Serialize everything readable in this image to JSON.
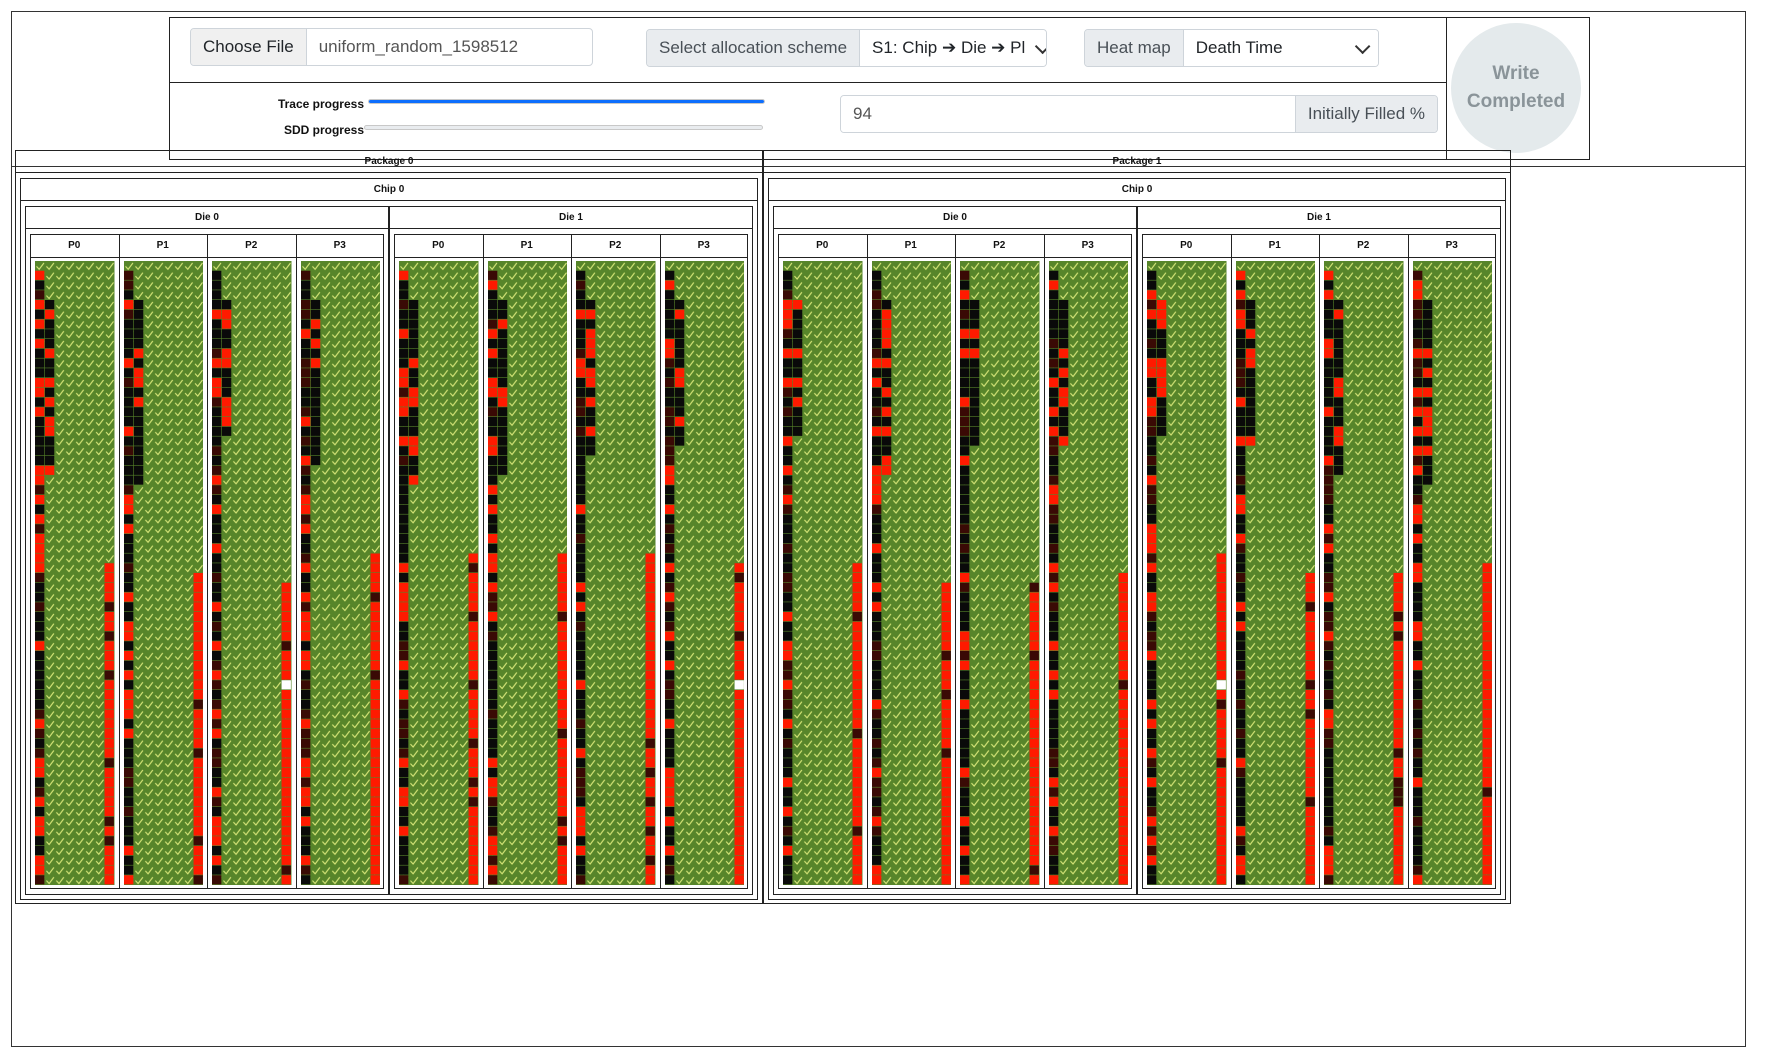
{
  "controls": {
    "choose_file_label": "Choose File",
    "file_name": "uniform_random_1598512",
    "allocation_label": "Select allocation scheme",
    "allocation_value": "S1: Chip ➔ Die ➔ Pl",
    "heatmap_label": "Heat map",
    "heatmap_value": "Death Time",
    "initially_filled_value": "94",
    "initially_filled_label": "Initially Filled %",
    "trace_progress_label": "Trace progress",
    "trace_progress": 1.0,
    "sdd_progress_label": "SDD progress",
    "sdd_progress": 0.0,
    "write_status": "Write Completed"
  },
  "colors": {
    "accent": "#0d6efd",
    "cell_valid": "#57852a",
    "cell_check": "#d9e87a",
    "cell_free": "#0a0a0a",
    "cell_dark_red": "#3a0a05",
    "cell_red": "#ff1a00",
    "cell_empty": "#ffffff"
  },
  "ssd": {
    "packages": [
      {
        "label": "Package 0",
        "chips": [
          {
            "label": "Chip 0",
            "dies": [
              {
                "label": "Die 0",
                "planes": [
                  "P0",
                  "P1",
                  "P2",
                  "P3"
                ]
              },
              {
                "label": "Die 1",
                "planes": [
                  "P0",
                  "P1",
                  "P2",
                  "P3"
                ]
              }
            ]
          }
        ]
      },
      {
        "label": "Package 1",
        "chips": [
          {
            "label": "Chip 0",
            "dies": [
              {
                "label": "Die 0",
                "planes": [
                  "P0",
                  "P1",
                  "P2",
                  "P3"
                ]
              },
              {
                "label": "Die 1",
                "planes": [
                  "P0",
                  "P1",
                  "P2",
                  "P3"
                ]
              }
            ]
          }
        ]
      }
    ]
  }
}
